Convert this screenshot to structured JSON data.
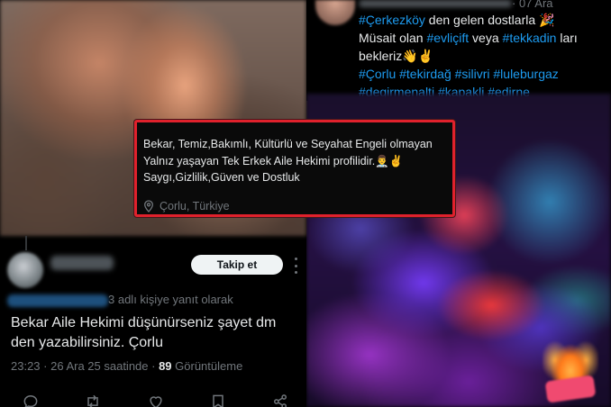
{
  "reply_tweet": {
    "follow_label": "Takip et",
    "replying_to_text": "3 adlı kişiye yanıt olarak",
    "text": "Bekar Aile Hekimi düşünürseniz şayet dm den yazabilirsiniz. Çorlu",
    "timestamp": "23:23 · 26 Ara 25 saatinde · ",
    "views_count": "89",
    "views_label": " Görüntüleme"
  },
  "right_tweet": {
    "time": "· 07 Ara",
    "line1_tag": "#Çerkezköy",
    "line1_text": " den gelen dostlarla 🎉",
    "line2_pre": "Müsait olan ",
    "line2_tag1": "#evliçift",
    "line2_mid": " veya ",
    "line2_tag2": "#tekkadin",
    "line2_post": " ları",
    "line3": "bekleriz👋✌️",
    "tags_line1": "#Çorlu #tekirdağ #silivri #luleburgaz",
    "tags_line2": "#degirmenalti #kapakli #edirne"
  },
  "profile_card": {
    "bio": "Bekar, Temiz,Bakımlı, Kültürlü ve Seyahat Engeli olmayan Yalnız yaşayan Tek Erkek Aile Hekimi profilidir.👨‍⚕️✌️ Saygı,Gizlilik,Güven ve Dostluk",
    "location": "Çorlu, Türkiye"
  },
  "icons": [
    "more-icon",
    "reply-icon",
    "retweet-icon",
    "like-icon",
    "bookmark-icon",
    "share-icon",
    "location-pin-icon"
  ],
  "colors": {
    "background": "#000000",
    "text": "#e7e9ea",
    "muted": "#71767b",
    "link": "#1d9bf0",
    "highlight_border": "#e0212c",
    "follow_button_bg": "#eff3f4"
  }
}
